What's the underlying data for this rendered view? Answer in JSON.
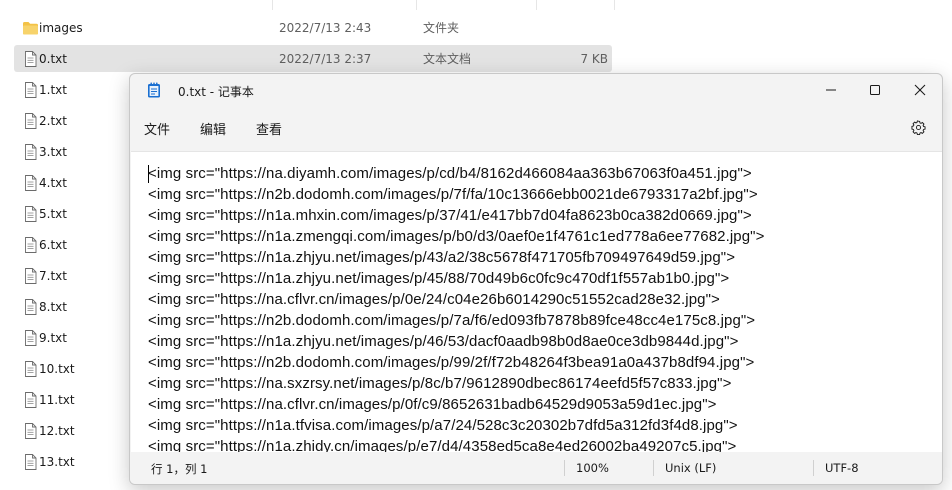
{
  "explorer": {
    "files": [
      {
        "name": "images",
        "date": "2022/7/13 2:43",
        "type": "文件夹",
        "size": "",
        "kind": "folder",
        "selected": false
      },
      {
        "name": "0.txt",
        "date": "2022/7/13 2:37",
        "type": "文本文档",
        "size": "7 KB",
        "kind": "text",
        "selected": true
      },
      {
        "name": "1.txt",
        "date": "",
        "type": "",
        "size": "",
        "kind": "text",
        "selected": false
      },
      {
        "name": "2.txt",
        "date": "",
        "type": "",
        "size": "",
        "kind": "text",
        "selected": false
      },
      {
        "name": "3.txt",
        "date": "",
        "type": "",
        "size": "",
        "kind": "text",
        "selected": false
      },
      {
        "name": "4.txt",
        "date": "",
        "type": "",
        "size": "",
        "kind": "text",
        "selected": false
      },
      {
        "name": "5.txt",
        "date": "",
        "type": "",
        "size": "",
        "kind": "text",
        "selected": false
      },
      {
        "name": "6.txt",
        "date": "",
        "type": "",
        "size": "",
        "kind": "text",
        "selected": false
      },
      {
        "name": "7.txt",
        "date": "",
        "type": "",
        "size": "",
        "kind": "text",
        "selected": false
      },
      {
        "name": "8.txt",
        "date": "",
        "type": "",
        "size": "",
        "kind": "text",
        "selected": false
      },
      {
        "name": "9.txt",
        "date": "",
        "type": "",
        "size": "",
        "kind": "text",
        "selected": false
      },
      {
        "name": "10.txt",
        "date": "",
        "type": "",
        "size": "",
        "kind": "text",
        "selected": false
      },
      {
        "name": "11.txt",
        "date": "",
        "type": "",
        "size": "",
        "kind": "text",
        "selected": false
      },
      {
        "name": "12.txt",
        "date": "",
        "type": "",
        "size": "",
        "kind": "text",
        "selected": false
      },
      {
        "name": "13.txt",
        "date": "",
        "type": "",
        "size": "",
        "kind": "text",
        "selected": false
      }
    ]
  },
  "notepad": {
    "title": "0.txt - 记事本",
    "icon": "notepad-icon",
    "menu": [
      "文件",
      "编辑",
      "查看"
    ],
    "lines": [
      "<img src=\"https://na.diyamh.com/images/p/cd/b4/8162d466084aa363b67063f0a451.jpg\">",
      "<img src=\"https://n2b.dodomh.com/images/p/7f/fa/10c13666ebb0021de6793317a2bf.jpg\">",
      "<img src=\"https://n1a.mhxin.com/images/p/37/41/e417bb7d04fa8623b0ca382d0669.jpg\">",
      "<img src=\"https://n1a.zmengqi.com/images/p/b0/d3/0aef0e1f4761c1ed778a6ee77682.jpg\">",
      "<img src=\"https://n1a.zhjyu.net/images/p/43/a2/38c5678f471705fb709497649d59.jpg\">",
      "<img src=\"https://n1a.zhjyu.net/images/p/45/88/70d49b6c0fc9c470df1f557ab1b0.jpg\">",
      "<img src=\"https://na.cflvr.cn/images/p/0e/24/c04e26b6014290c51552cad28e32.jpg\">",
      "<img src=\"https://n2b.dodomh.com/images/p/7a/f6/ed093fb7878b89fce48cc4e175c8.jpg\">",
      "<img src=\"https://n1a.zhjyu.net/images/p/46/53/dacf0aadb98b0d8ae0ce3db9844d.jpg\">",
      "<img src=\"https://n2b.dodomh.com/images/p/99/2f/f72b48264f3bea91a0a437b8df94.jpg\">",
      "<img src=\"https://na.sxzrsy.net/images/p/8c/b7/9612890dbec86174eefd5f57c833.jpg\">",
      "<img src=\"https://na.cflvr.cn/images/p/0f/c9/8652631badb64529d9053a59d1ec.jpg\">",
      "<img src=\"https://n1a.tfvisa.com/images/p/a7/24/528c3c20302b7dfd5a312fd3f4d8.jpg\">",
      "<img src=\"https://n1a.zhidy.cn/images/p/e7/d4/4358ed5ca8e4ed26002ba49207c5.jpg\">"
    ],
    "status": {
      "position": "行 1，列 1",
      "zoom": "100%",
      "line_ending": "Unix (LF)",
      "encoding": "UTF-8"
    }
  },
  "colors": {
    "selected_row": "#e3e3e3",
    "notepad_icon": "#1a6fd1",
    "folder": "#f3c246"
  }
}
